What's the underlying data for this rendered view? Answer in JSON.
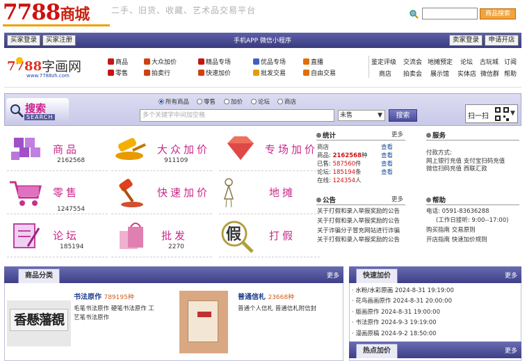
{
  "header": {
    "logo_num": "7788",
    "logo_cn": "商城",
    "slogan": "二手、旧货、收藏、艺术品交易平台",
    "search_button": "商品搜索",
    "search_value": ""
  },
  "navbar": {
    "buyer_login": "买家登录",
    "buyer_register": "买家注册",
    "app_text": "手机APP   微信小程序",
    "seller_login": "卖家登录",
    "open_shop": "申请开店"
  },
  "site_logo": {
    "text": "字画网",
    "url_text": "www.7788zh.com",
    "num": "7788"
  },
  "categories": [
    {
      "label": "商品",
      "color": "#c81414"
    },
    {
      "label": "零售",
      "color": "#c81414"
    },
    {
      "label": "大众加价",
      "color": "#d04010"
    },
    {
      "label": "拍卖行",
      "color": "#d04010"
    },
    {
      "label": "精品专场",
      "color": "#c81414"
    },
    {
      "label": "快速加价",
      "color": "#d04010"
    },
    {
      "label": "优品专场",
      "color": "#4060c0"
    },
    {
      "label": "批发交易",
      "color": "#e0a000"
    },
    {
      "label": "直播",
      "color": "#e07000"
    },
    {
      "label": "自由交易",
      "color": "#e07000"
    }
  ],
  "service_links": [
    [
      "鉴定评级",
      "交流会",
      "地摊预定",
      "论坛",
      "古玩城",
      "订阅"
    ],
    [
      "商店",
      "拍卖会",
      "展示馆",
      "实体店",
      "微信群",
      "帮助"
    ]
  ],
  "search": {
    "radios": [
      "所有商品",
      "零售",
      "加价",
      "论坛",
      "商店"
    ],
    "selected_radio": "所有商品",
    "placeholder": "多个关键字中间加空格",
    "select_value": "未售",
    "button": "搜索",
    "logo_cn": "搜索",
    "logo_en": "SEARCH",
    "scan_label": "扫一扫"
  },
  "tiles": [
    {
      "title": "商品",
      "count": "2162568"
    },
    {
      "title": "大众加价",
      "count": "911109"
    },
    {
      "title": "专场加价",
      "count": ""
    },
    {
      "title": "零售",
      "count": "1247554"
    },
    {
      "title": "快速加价",
      "count": ""
    },
    {
      "title": "地摊",
      "count": ""
    },
    {
      "title": "论坛",
      "count": "185194"
    },
    {
      "title": "批发",
      "count": "2270"
    },
    {
      "title": "打假",
      "count": ""
    }
  ],
  "stats": {
    "title": "统计",
    "more": "更多",
    "store_label": "商店",
    "rows": [
      {
        "label": "商品:",
        "value": "2162568",
        "unit": "种",
        "action": "查看"
      },
      {
        "label": "已售:",
        "value": "587560",
        "unit": "件",
        "action": "查看"
      },
      {
        "label": "论坛:",
        "value": "185194",
        "unit": "条",
        "action": "查看"
      },
      {
        "label": "在线:",
        "value": "124354",
        "unit": "人",
        "action": ""
      }
    ]
  },
  "notice": {
    "title": "公告",
    "more": "更多",
    "items": [
      "关于打假和录入举报奖励的公告",
      "关于打假和录入举报奖励的公告",
      "关于诈骗分子冒充网站进行诈骗",
      "关于打假和录入举报奖励的公告"
    ]
  },
  "service": {
    "title": "服务",
    "pay_title": "付款方式:",
    "pay_line1": "网上银行充值   支付宝扫码充值",
    "pay_line2": "微信扫码充值   西联汇款"
  },
  "help": {
    "title": "帮助",
    "phone": "电话:  0591-83636288",
    "hours": "(工作日接听:  9:00--17:00)",
    "line1": "购买指南   交易原则",
    "line2": "开店指南   快速加价规则"
  },
  "goods": {
    "tab": "商品分类",
    "more": "更多",
    "items": [
      {
        "title": "书法原作",
        "count": "789195种",
        "desc": "毛笔书法原作   硬笔书法原作   工艺笔书法原作"
      },
      {
        "title": "普通信札",
        "count": "23668种",
        "desc": "普通个人信札   普通信札附信封"
      }
    ]
  },
  "quick": {
    "title": "快速加价",
    "more": "更多",
    "items": [
      {
        "name": "水粉/水彩原画",
        "time": "2024-8-31 19:19:00"
      },
      {
        "name": "花鸟画画原作",
        "time": "2024-8-31 20:00:00"
      },
      {
        "name": "版画原作",
        "time": "2024-8-31 19:00:00"
      },
      {
        "name": "书法原作",
        "time": "2024-9-3 19:19:00"
      },
      {
        "name": "漫画原稿",
        "time": "2024-9-2 18:50:00"
      }
    ]
  },
  "hot": {
    "title": "热点加价",
    "more": "更多"
  }
}
